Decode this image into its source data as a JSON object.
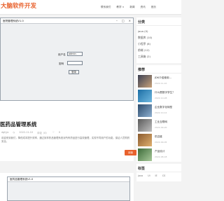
{
  "header": {
    "logo": "大脑软件开发",
    "nav": [
      "联系我们",
      "教学 ∨",
      "新闻",
      "资讯",
      "首页"
    ]
  },
  "article": {
    "screenshot": {
      "window_title": "医院管理系统V1.0",
      "username_label": "用户名",
      "username_value": "admin",
      "password_label": "密码",
      "password_value": "",
      "login_button": "登录"
    },
    "title": "医药品管理系统",
    "meta": {
      "author": "dgfyjx",
      "date": "2022-11-10",
      "views": "评论（0）",
      "likes": "0"
    },
    "summary": "欢迎来到我们，降低成本提升效率，通过到享药品管理系统对所有药品进行高效管理，实现不同用户的功能，保证人员购药安全。",
    "readmore": "阅读"
  },
  "article2": {
    "window_title": "医药品管理系统V1.0"
  },
  "sidebar": {
    "categories_title": "分类",
    "categories": [
      "java (0)",
      "数据库 (10)",
      "小程序 (8)",
      "前端 (12)",
      "工具箱 (2)"
    ],
    "recommend_title": "推荐",
    "recommend": [
      {
        "title": "JDK介绍使用...",
        "date": "2022-11-10"
      },
      {
        "title": "什么是数字学生？",
        "date": "2022-10-28"
      },
      {
        "title": "企业数字化转型",
        "date": "2022-10-12"
      },
      {
        "title": "工业互联网",
        "date": "2022-09-20"
      },
      {
        "title": "供应链",
        "date": "2022-09-05"
      },
      {
        "title": "产品设计",
        "date": "2022-08-18"
      }
    ],
    "tags_title": "标签",
    "tags": [
      "java",
      "Ui",
      "IE",
      "CS"
    ]
  }
}
